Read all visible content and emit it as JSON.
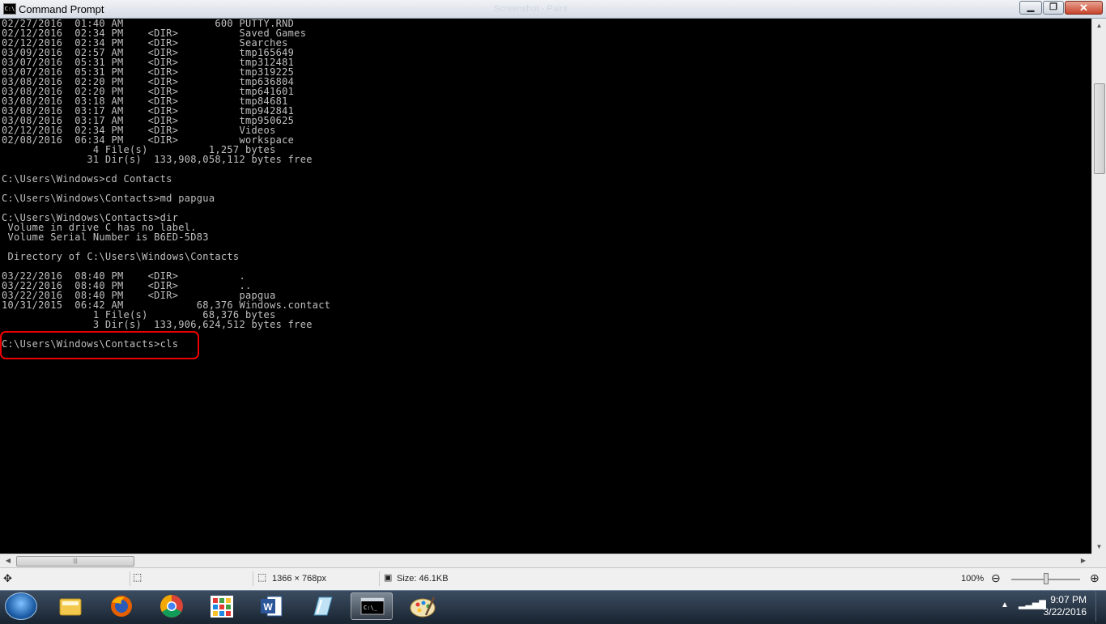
{
  "window": {
    "title": "Command Prompt",
    "ghost_title": "Screenshot - Paint",
    "minimize_glyph": "▁",
    "maximize_glyph": "❐",
    "close_glyph": "✕"
  },
  "console_lines": [
    "02/27/2016  01:40 AM               600 PUTTY.RND",
    "02/12/2016  02:34 PM    <DIR>          Saved Games",
    "02/12/2016  02:34 PM    <DIR>          Searches",
    "03/09/2016  02:57 AM    <DIR>          tmp165649",
    "03/07/2016  05:31 PM    <DIR>          tmp312481",
    "03/07/2016  05:31 PM    <DIR>          tmp319225",
    "03/08/2016  02:20 PM    <DIR>          tmp636804",
    "03/08/2016  02:20 PM    <DIR>          tmp641601",
    "03/08/2016  03:18 AM    <DIR>          tmp84681",
    "03/08/2016  03:17 AM    <DIR>          tmp942841",
    "03/08/2016  03:17 AM    <DIR>          tmp950625",
    "02/12/2016  02:34 PM    <DIR>          Videos",
    "02/08/2016  06:34 PM    <DIR>          workspace",
    "               4 File(s)          1,257 bytes",
    "              31 Dir(s)  133,908,058,112 bytes free",
    "",
    "C:\\Users\\Windows>cd Contacts",
    "",
    "C:\\Users\\Windows\\Contacts>md papgua",
    "",
    "C:\\Users\\Windows\\Contacts>dir",
    " Volume in drive C has no label.",
    " Volume Serial Number is B6ED-5D83",
    "",
    " Directory of C:\\Users\\Windows\\Contacts",
    "",
    "03/22/2016  08:40 PM    <DIR>          .",
    "03/22/2016  08:40 PM    <DIR>          ..",
    "03/22/2016  08:40 PM    <DIR>          papgua",
    "10/31/2015  06:42 AM            68,376 Windows.contact",
    "               1 File(s)         68,376 bytes",
    "               3 Dir(s)  133,906,624,512 bytes free",
    "",
    "C:\\Users\\Windows\\Contacts>cls"
  ],
  "statusbar": {
    "dimensions": "1366 × 768px",
    "size": "Size: 46.1KB",
    "zoom": "100%",
    "zoom_out_glyph": "⊖",
    "zoom_in_glyph": "⊕",
    "zoom_level_percent": 100
  },
  "taskbar": {
    "items": [
      "explorer-icon",
      "firefox-icon",
      "chrome-icon",
      "apps-grid-icon",
      "word-icon",
      "notepad-icon",
      "cmd-icon",
      "paint-icon"
    ],
    "active_item": "cmd-icon",
    "time": "9:07 PM",
    "date": "3/22/2016"
  },
  "annotation_color": "#e00000"
}
